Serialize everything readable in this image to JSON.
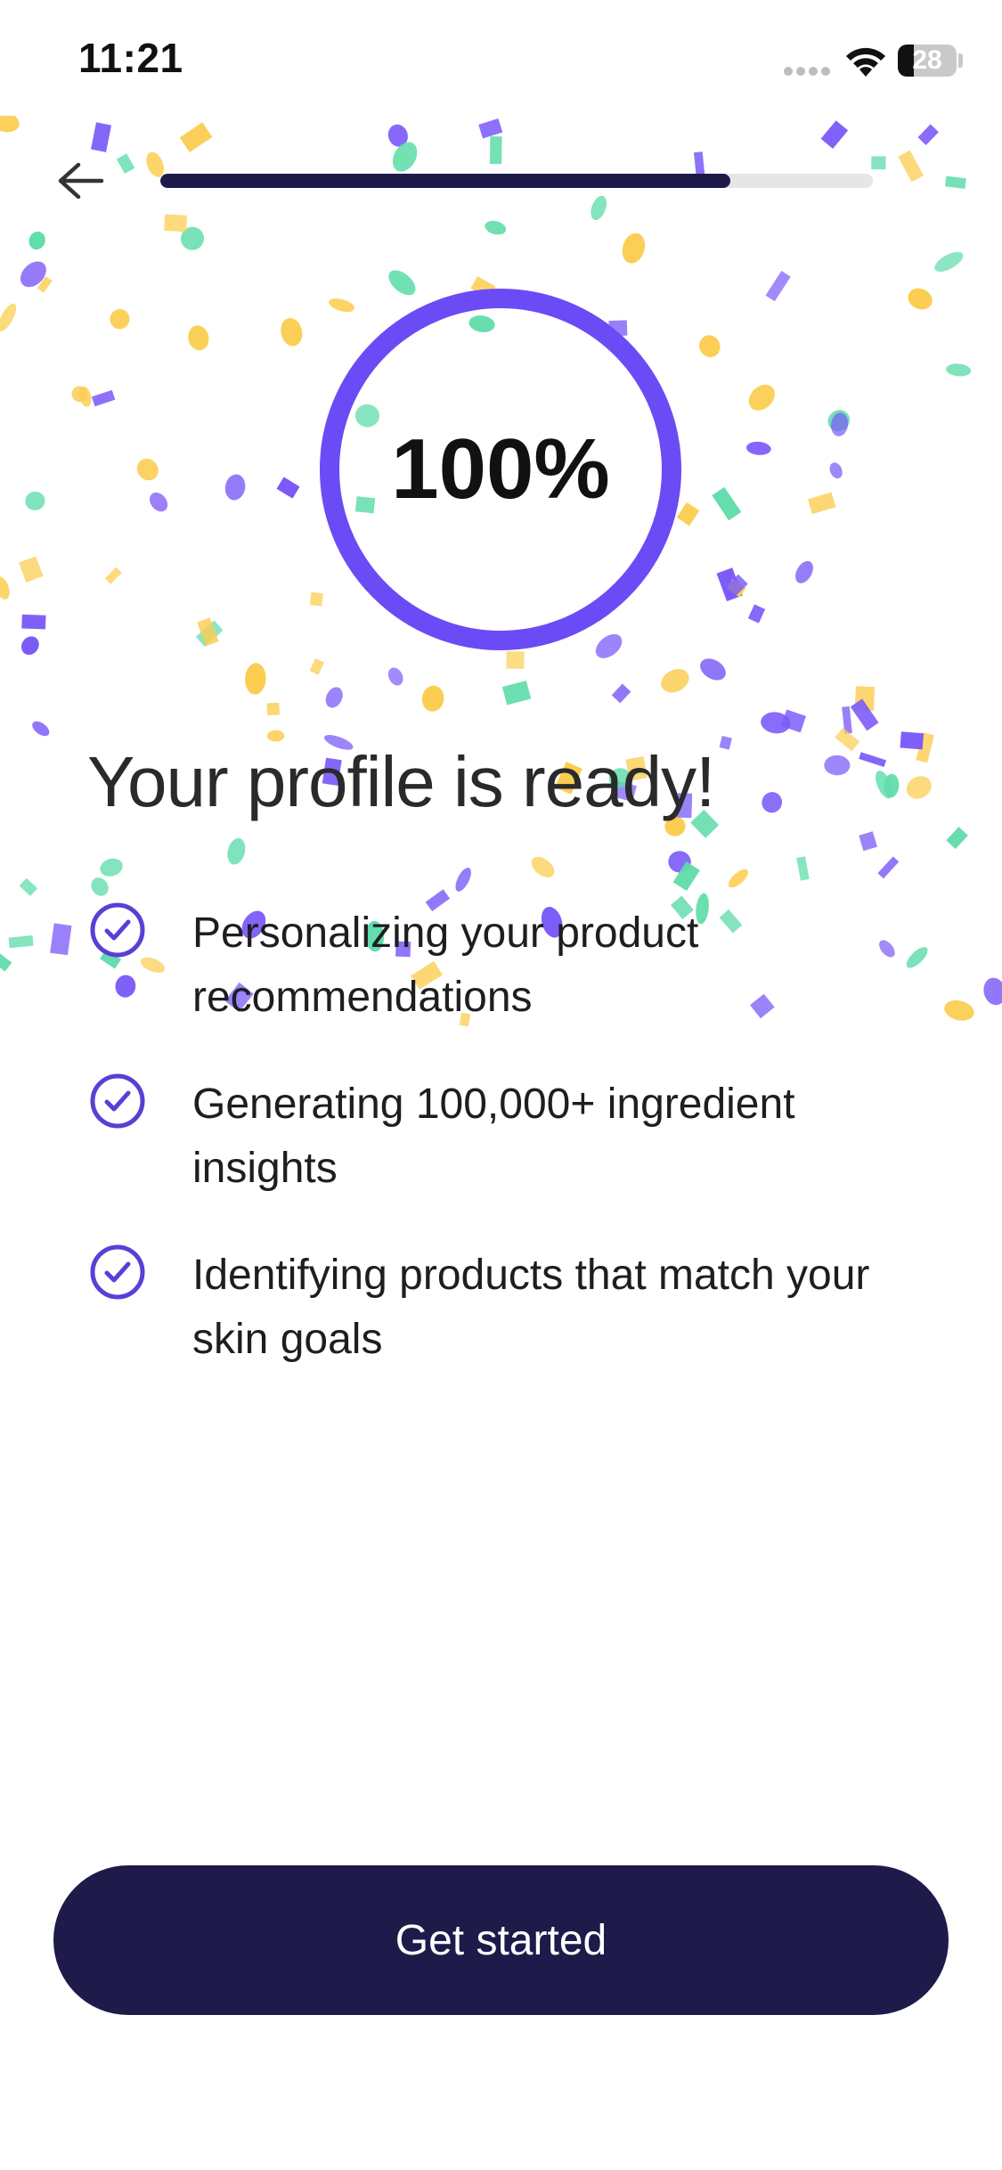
{
  "status_bar": {
    "time": "11:21",
    "battery_percent": "28",
    "icons": [
      "signal-icon",
      "wifi-icon",
      "battery-icon"
    ]
  },
  "header": {
    "back_icon": "arrow-left-icon",
    "progress_fraction": 0.8
  },
  "completion": {
    "percent_label": "100%",
    "percent_value": 100
  },
  "title": "Your profile is ready!",
  "checklist": [
    {
      "icon": "check-circle-icon",
      "text": "Personalizing your product recommendations"
    },
    {
      "icon": "check-circle-icon",
      "text": "Generating 100,000+ ingredient insights"
    },
    {
      "icon": "check-circle-icon",
      "text": "Identifying products that match your skin goals"
    }
  ],
  "cta": {
    "label": "Get started"
  },
  "colors": {
    "accent": "#6a4bf5",
    "navy": "#1e1b4b",
    "confetti_green": "#5fdcaa",
    "confetti_yellow": "#fbcd50",
    "confetti_purple": "#7a5af8"
  }
}
